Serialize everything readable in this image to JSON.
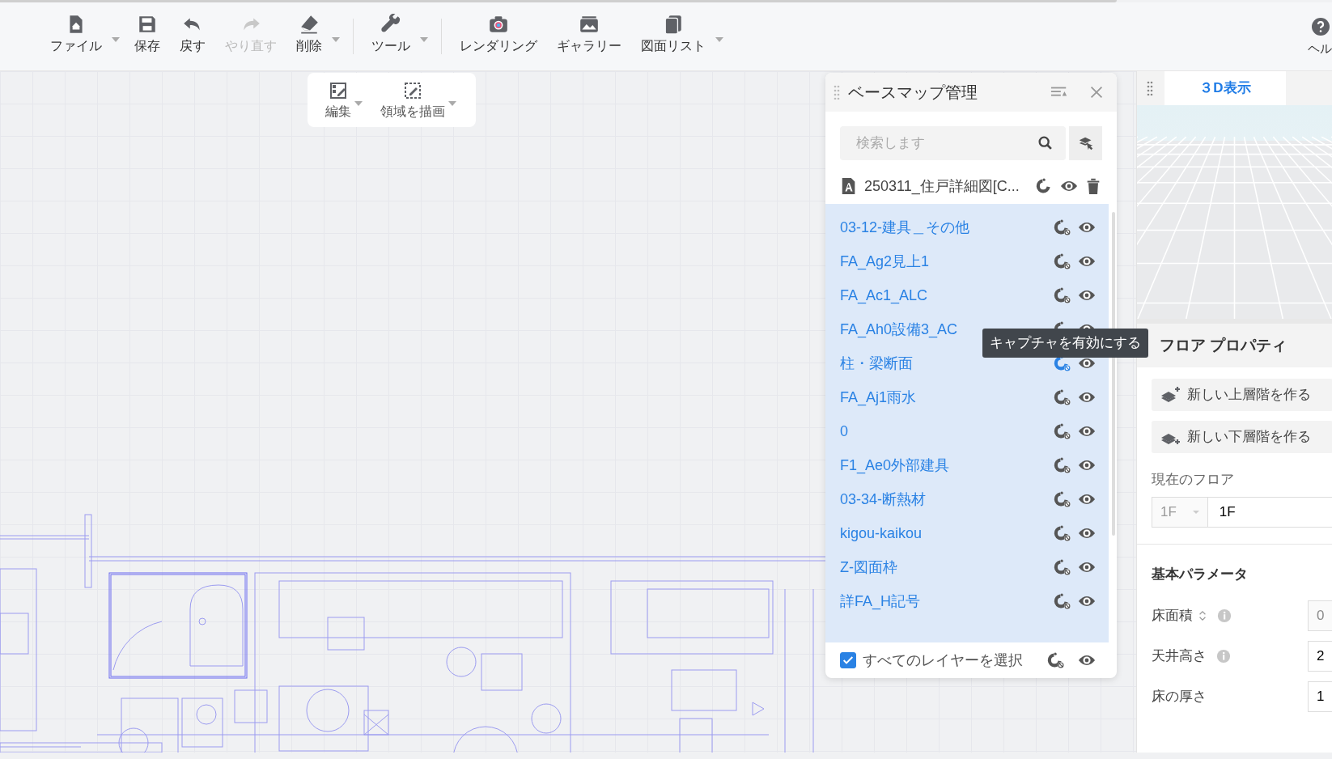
{
  "toolbar": {
    "groups": [
      [
        {
          "label": "ファイル",
          "kind": "file",
          "disabled": false,
          "has_menu": true
        },
        {
          "label": "保存",
          "kind": "save",
          "disabled": false,
          "has_menu": false
        },
        {
          "label": "戻す",
          "kind": "undo",
          "disabled": false,
          "has_menu": false
        },
        {
          "label": "やり直す",
          "kind": "redo",
          "disabled": true,
          "has_menu": false
        },
        {
          "label": "削除",
          "kind": "eraser",
          "disabled": false,
          "has_menu": true
        }
      ],
      [
        {
          "label": "ツール",
          "kind": "wrench",
          "disabled": false,
          "has_menu": true
        }
      ],
      [
        {
          "label": "レンダリング",
          "kind": "camera",
          "disabled": false,
          "has_menu": false
        },
        {
          "label": "ギャラリー",
          "kind": "gallery",
          "disabled": false,
          "has_menu": false
        },
        {
          "label": "図面リスト",
          "kind": "pages",
          "disabled": false,
          "has_menu": true
        }
      ]
    ],
    "help": {
      "label": "ヘル"
    }
  },
  "sub_toolbar": [
    {
      "label": "編集",
      "kind": "edit",
      "has_menu": true
    },
    {
      "label": "領域を描画",
      "kind": "area",
      "has_menu": true
    }
  ],
  "basemap_panel": {
    "title": "ベースマップ管理",
    "search": {
      "placeholder": "検索します"
    },
    "file": {
      "name": "250311_住戸詳細図[C..."
    },
    "layers": [
      {
        "name": "03-12-建具＿その他",
        "hovered": false
      },
      {
        "name": "FA_Ag2見上1",
        "hovered": false
      },
      {
        "name": "FA_Ac1_ALC",
        "hovered": false
      },
      {
        "name": "FA_Ah0設備3_AC",
        "hovered": false
      },
      {
        "name": "柱・梁断面",
        "hovered": true
      },
      {
        "name": "FA_Aj1雨水",
        "hovered": false
      },
      {
        "name": "0",
        "hovered": false
      },
      {
        "name": "F1_Ae0外部建具",
        "hovered": false
      },
      {
        "name": "03-34-断熱材",
        "hovered": false
      },
      {
        "name": "kigou-kaikou",
        "hovered": false
      },
      {
        "name": "Z-図面枠",
        "hovered": false
      },
      {
        "name": "詳FA_H記号",
        "hovered": false
      }
    ],
    "select_all": {
      "label": "すべてのレイヤーを選択",
      "checked": true
    },
    "tooltip": "キャプチャを有効にする"
  },
  "right_panel": {
    "tab": {
      "label": "３D表示",
      "selected": true
    },
    "floor_properties": {
      "title": "フロア プロパティ",
      "buttons": [
        {
          "label": "新しい上層階を作る",
          "kind": "up"
        },
        {
          "label": "新しい下層階を作る",
          "kind": "down"
        }
      ],
      "current_floor": {
        "label": "現在のフロア",
        "select": "1F",
        "select_disabled": true,
        "value": "1F"
      },
      "section": "基本パラメータ",
      "params": [
        {
          "label": "床面積",
          "sortable": true,
          "info": true,
          "value": "0",
          "disabled": true
        },
        {
          "label": "天井高さ",
          "sortable": false,
          "info": true,
          "value": "2",
          "disabled": false
        },
        {
          "label": "床の厚さ",
          "sortable": false,
          "info": false,
          "value": "1",
          "disabled": false
        }
      ]
    }
  }
}
